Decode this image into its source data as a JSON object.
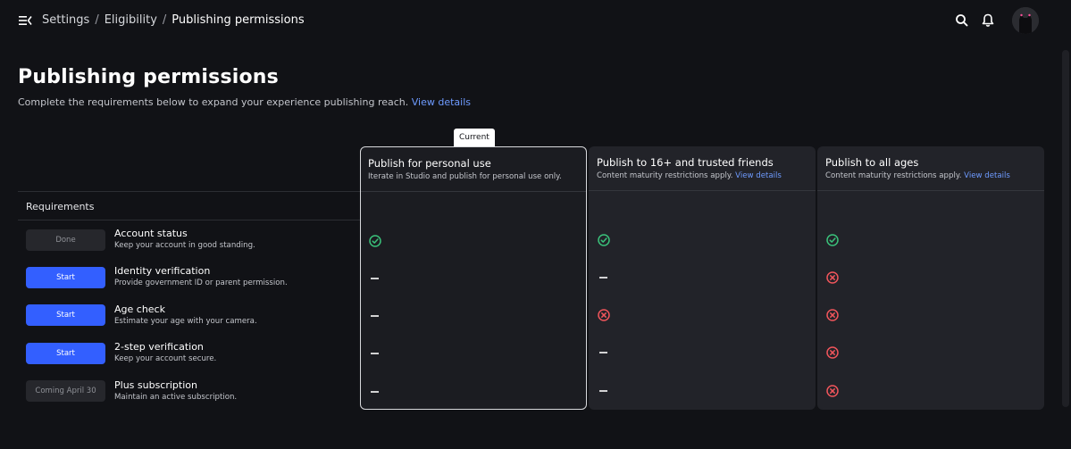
{
  "breadcrumb": [
    "Settings",
    "Eligibility",
    "Publishing permissions"
  ],
  "page": {
    "title": "Publishing permissions",
    "subtitle": "Complete the requirements below to expand your experience publishing reach.",
    "subtitle_link": "View details"
  },
  "current_tag": "Current",
  "requirements_heading": "Requirements",
  "columns": [
    {
      "title": "Publish for personal use",
      "desc": "Iterate in Studio and publish for personal use only.",
      "link": ""
    },
    {
      "title": "Publish to 16+ and trusted friends",
      "desc": "Content maturity restrictions apply.",
      "link": "View details"
    },
    {
      "title": "Publish to all ages",
      "desc": "Content maturity restrictions apply.",
      "link": "View details"
    }
  ],
  "requirements": [
    {
      "action": "Done",
      "name": "Account status",
      "desc": "Keep your account in good standing.",
      "states": [
        "met",
        "met",
        "met"
      ]
    },
    {
      "action": "Start",
      "name": "Identity verification",
      "desc": "Provide government ID or parent permission.",
      "states": [
        "not-required",
        "not-required",
        "unmet"
      ]
    },
    {
      "action": "Start",
      "name": "Age check",
      "desc": "Estimate your age with your camera.",
      "states": [
        "not-required",
        "unmet",
        "unmet"
      ]
    },
    {
      "action": "Start",
      "name": "2-step verification",
      "desc": "Keep your account secure.",
      "states": [
        "not-required",
        "not-required",
        "unmet"
      ]
    },
    {
      "action": "Coming April 30",
      "name": "Plus subscription",
      "desc": "Maintain an active subscription.",
      "states": [
        "not-required",
        "not-required",
        "unmet"
      ]
    }
  ],
  "icons": {
    "menu": "menu-collapse-icon",
    "search": "search-icon",
    "notifications": "bell-icon",
    "met": "check-circle-icon",
    "unmet": "x-circle-icon",
    "not_required": "dash-icon"
  },
  "colors": {
    "primary_button": "#335fff",
    "link": "#6e9bff",
    "met": "#3ac17a",
    "unmet": "#f0555b"
  }
}
